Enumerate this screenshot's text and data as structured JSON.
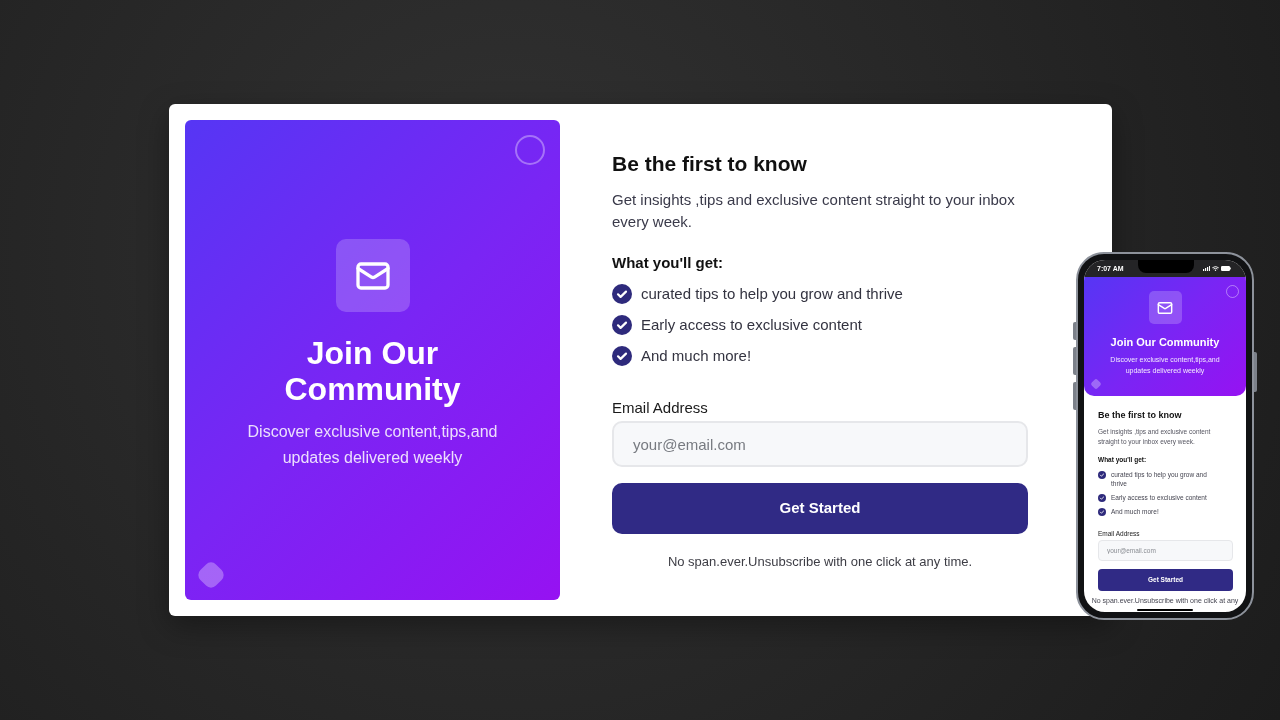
{
  "desktop": {
    "banner": {
      "title": "Join Our Community",
      "subtitle": "Discover exclusive content,tips,and updates delivered weekly"
    },
    "form": {
      "heading": "Be the first to know",
      "description": "Get insights ,tips and exclusive content straight to your inbox every week.",
      "benefits_title": "What you'll get:",
      "benefits": [
        "curated tips to help you grow and thrive",
        "Early access to exclusive content",
        "And much more!"
      ],
      "email": {
        "label": "Email Address",
        "placeholder": "your@email.com"
      },
      "button": "Get Started",
      "note": "No span.ever.Unsubscribe with one click at any time."
    }
  },
  "phone": {
    "status_bar": {
      "time": "7:07 AM"
    },
    "banner": {
      "title": "Join Our Community",
      "subtitle": "Discover exclusive content,tips,and updates delivered weekly"
    },
    "form": {
      "heading": "Be the first to know",
      "description": "Get insights ,tips and exclusive content straight to your inbox every week.",
      "benefits_title": "What you'll get:",
      "benefits": [
        "curated tips to help you grow and thrive",
        "Early access to exclusive content",
        "And much more!"
      ],
      "email": {
        "label": "Email Address",
        "placeholder": "your@email.com"
      },
      "button": "Get Started",
      "note": "No span.ever.Unsubscribe with one click at any"
    }
  }
}
